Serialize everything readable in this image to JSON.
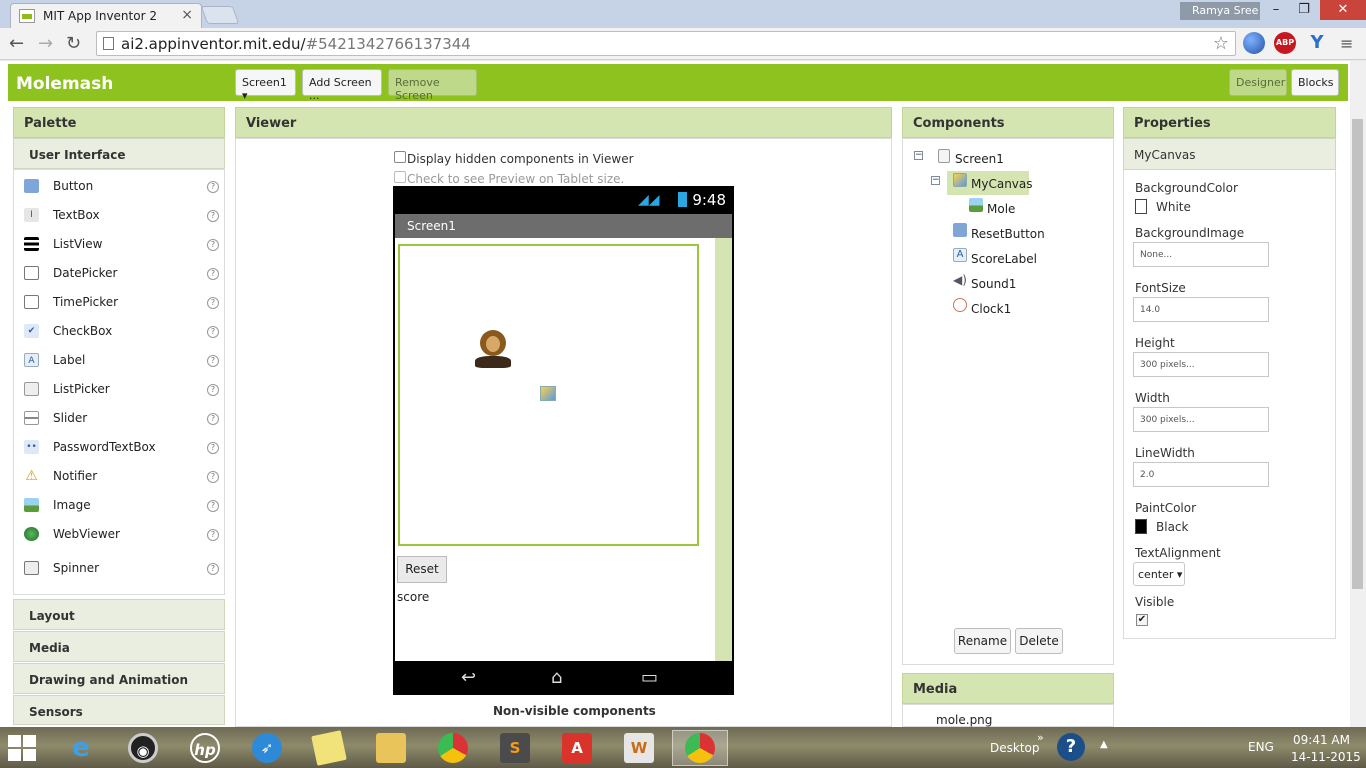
{
  "browser": {
    "tab_title": "MIT App Inventor 2",
    "tab_close": "×",
    "user": "Ramya Sree",
    "url_host": "ai2.appinventor.mit.edu/",
    "url_hash": "#5421342766137344",
    "win_min": "–",
    "win_max": "❐",
    "win_close": "✕",
    "back": "←",
    "forward": "→",
    "reload": "↻",
    "star": "☆",
    "abp": "ABP",
    "ext_y": "Y",
    "menu": "≡"
  },
  "header": {
    "project": "Molemash",
    "screen_select": "Screen1 ▾",
    "add_screen": "Add Screen ...",
    "remove_screen": "Remove Screen",
    "designer": "Designer",
    "blocks": "Blocks"
  },
  "palette": {
    "title": "Palette",
    "open_category": "User Interface",
    "items": [
      {
        "label": "Button",
        "icon": "button-icon"
      },
      {
        "label": "TextBox",
        "icon": "textbox-icon"
      },
      {
        "label": "ListView",
        "icon": "listview-icon"
      },
      {
        "label": "DatePicker",
        "icon": "datepicker-icon"
      },
      {
        "label": "TimePicker",
        "icon": "timepicker-icon"
      },
      {
        "label": "CheckBox",
        "icon": "checkbox-icon"
      },
      {
        "label": "Label",
        "icon": "label-icon"
      },
      {
        "label": "ListPicker",
        "icon": "listpicker-icon"
      },
      {
        "label": "Slider",
        "icon": "slider-icon"
      },
      {
        "label": "PasswordTextBox",
        "icon": "passwordtextbox-icon"
      },
      {
        "label": "Notifier",
        "icon": "notifier-icon"
      },
      {
        "label": "Image",
        "icon": "image-icon"
      },
      {
        "label": "WebViewer",
        "icon": "webviewer-icon"
      },
      {
        "label": "Spinner",
        "icon": "spinner-icon"
      }
    ],
    "help": "?",
    "categories": [
      "Layout",
      "Media",
      "Drawing and Animation",
      "Sensors"
    ]
  },
  "viewer": {
    "title": "Viewer",
    "hidden_components": "Display hidden components in Viewer",
    "tablet_preview": "Check to see Preview on Tablet size.",
    "time": "9:48",
    "screen_title": "Screen1",
    "reset_button": "Reset",
    "score_label": "score",
    "nav_back": "↩",
    "nav_home": "⌂",
    "nav_recent": "▭",
    "non_visible": "Non-visible components"
  },
  "components": {
    "title": "Components",
    "tree": [
      {
        "label": "Screen1",
        "icon": "screen-icon",
        "toggle": "−"
      },
      {
        "label": "MyCanvas",
        "icon": "canvas-icon",
        "toggle": "−",
        "selected": true
      },
      {
        "label": "Mole",
        "icon": "imagesprite-icon"
      },
      {
        "label": "ResetButton",
        "icon": "button-icon"
      },
      {
        "label": "ScoreLabel",
        "icon": "label-icon"
      },
      {
        "label": "Sound1",
        "icon": "sound-icon"
      },
      {
        "label": "Clock1",
        "icon": "clock-icon"
      }
    ],
    "rename": "Rename",
    "delete": "Delete"
  },
  "media": {
    "title": "Media",
    "files": [
      "mole.png"
    ]
  },
  "properties": {
    "title": "Properties",
    "component": "MyCanvas",
    "background_color_label": "BackgroundColor",
    "background_color_value": "White",
    "background_color_hex": "#ffffff",
    "background_image_label": "BackgroundImage",
    "background_image_value": "None...",
    "font_size_label": "FontSize",
    "font_size_value": "14.0",
    "height_label": "Height",
    "height_value": "300 pixels...",
    "width_label": "Width",
    "width_value": "300 pixels...",
    "line_width_label": "LineWidth",
    "line_width_value": "2.0",
    "paint_color_label": "PaintColor",
    "paint_color_value": "Black",
    "paint_color_hex": "#000000",
    "text_alignment_label": "TextAlignment",
    "text_alignment_value": "center ▾",
    "visible_label": "Visible",
    "visible_checked": "✔"
  },
  "taskbar": {
    "desktop": "Desktop",
    "language": "ENG",
    "time": "09:41 AM",
    "date": "14-11-2015",
    "apps": [
      "internet-explorer-icon",
      "media-player-icon",
      "hp-icon",
      "rocket-icon",
      "sticky-notes-icon",
      "file-explorer-icon",
      "chrome-icon",
      "sublime-icon",
      "acrobat-icon",
      "word-icon",
      "chrome-active-icon"
    ]
  },
  "colors": {
    "accent": "#8dc21f",
    "panel_header": "#d5e5b1"
  }
}
